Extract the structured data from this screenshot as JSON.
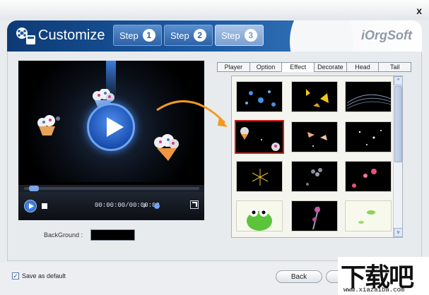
{
  "window": {
    "close_glyph": "x"
  },
  "header": {
    "title": "Customize",
    "steps": [
      {
        "label": "Step",
        "number": "1"
      },
      {
        "label": "Step",
        "number": "2"
      },
      {
        "label": "Step",
        "number": "3",
        "active": true
      }
    ],
    "brand": "iOrgSoft"
  },
  "player": {
    "timecode": "00:00:00/00:00:02",
    "seek_progress": 0.03,
    "icons": [
      "play-icon",
      "stop-icon",
      "volume-icon",
      "fullscreen-icon"
    ]
  },
  "background": {
    "label": "BackGround :",
    "color": "#000000"
  },
  "tabs": [
    {
      "label": "Player"
    },
    {
      "label": "Option"
    },
    {
      "label": "Effect",
      "active": true
    },
    {
      "label": "Decorate"
    },
    {
      "label": "Head"
    },
    {
      "label": "Tail"
    }
  ],
  "effects": {
    "selected_index": 3,
    "scroll_glyphs": {
      "up": "^",
      "down": "v"
    }
  },
  "footer": {
    "save_default_label": "Save as default",
    "save_default_checked": true,
    "back_label": "Back",
    "checkbox_glyph": "✓"
  },
  "watermark": {
    "big": "下载吧",
    "small": "www.xiazaiba.com"
  },
  "colors": {
    "accent": "#1b5aa3",
    "selection": "#d21d1d",
    "arrow": "#f39a1e"
  }
}
